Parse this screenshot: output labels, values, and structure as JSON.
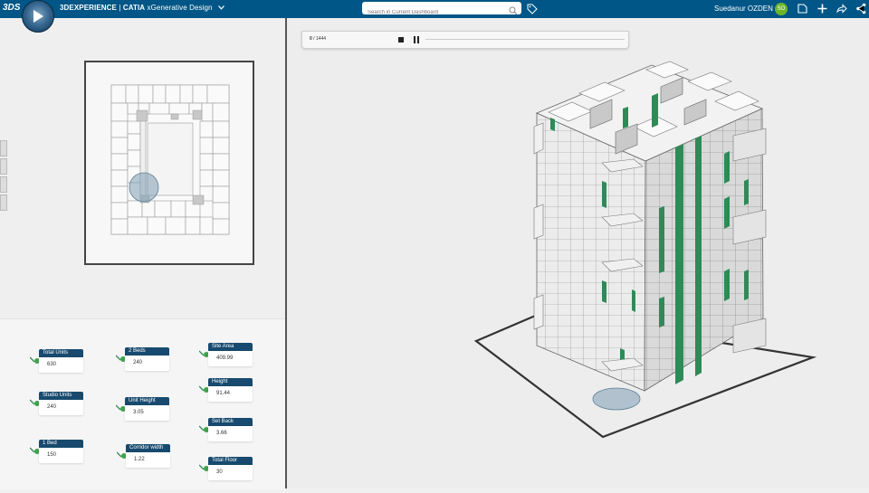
{
  "header": {
    "logo": "3DS",
    "brand_prefix": "3DEXPERIENCE",
    "brand_sep": " | ",
    "brand_app": "CATIA",
    "brand_module": " xGenerative Design",
    "search_placeholder": "Search in Current Dashboard",
    "user_name": "Suedanur OZDEN",
    "user_initials": "SO",
    "icons": [
      "compass-icon",
      "chevron-down-icon",
      "search-icon",
      "tag-icon",
      "feedback-icon",
      "plus-icon",
      "share-icon",
      "network-icon"
    ]
  },
  "player": {
    "frame_current": "0",
    "frame_total": "/ 1444"
  },
  "parameters": [
    {
      "label": "Total Units",
      "value": "630"
    },
    {
      "label": "Studio Units",
      "value": "240"
    },
    {
      "label": "1 Bed",
      "value": "150"
    },
    {
      "label": "2 Beds",
      "value": "240"
    },
    {
      "label": "Unit Height",
      "value": "3.05"
    },
    {
      "label": "Corridor width",
      "value": "1.22"
    },
    {
      "label": "Site Area",
      "value": "409.99"
    },
    {
      "label": "Height",
      "value": "91.44"
    },
    {
      "label": "Set Back",
      "value": "3.66"
    },
    {
      "label": "Total Floor",
      "value": "30"
    }
  ],
  "colors": {
    "topbar": "#005686",
    "card_label": "#174a6e",
    "accent_green": "#2e8b57",
    "avatar": "#6cb42c"
  }
}
